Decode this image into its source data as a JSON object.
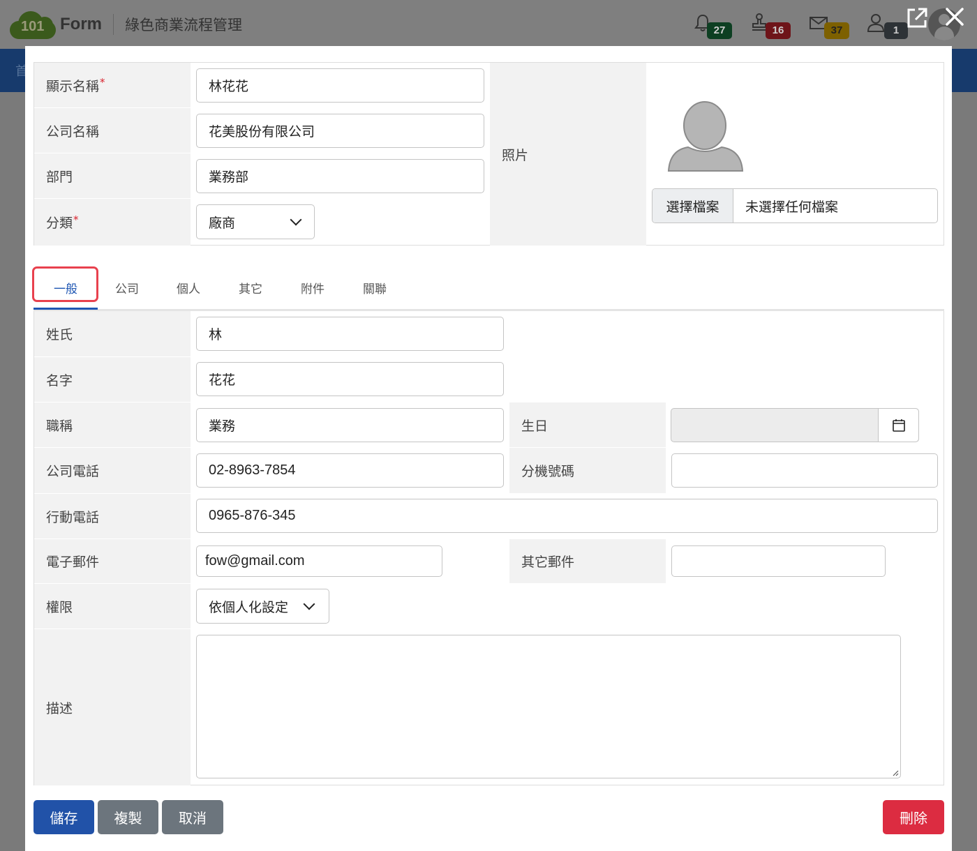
{
  "app": {
    "logo_number": "101",
    "logo_text": "Form",
    "title": "綠色商業流程管理",
    "nav_first_char": "首"
  },
  "header": {
    "notifications": [
      {
        "icon": "bell-icon",
        "count": "27",
        "color": "#0d3f22"
      },
      {
        "icon": "stamp-icon",
        "count": "16",
        "color": "#6e1419"
      },
      {
        "icon": "mail-icon",
        "count": "37",
        "color": "#7d6000"
      },
      {
        "icon": "user-icon",
        "count": "1",
        "color": "#2d3236"
      }
    ]
  },
  "form": {
    "display_name": {
      "label": "顯示名稱",
      "value": "林花花",
      "required": "*"
    },
    "company_name": {
      "label": "公司名稱",
      "value": "花美股份有限公司"
    },
    "department": {
      "label": "部門",
      "value": "業務部"
    },
    "category": {
      "label": "分類",
      "value": "廠商",
      "required": "*"
    },
    "photo": {
      "label": "照片",
      "choose_file": "選擇檔案",
      "file_status": "未選擇任何檔案"
    }
  },
  "tabs": [
    {
      "label": "一般",
      "active": true
    },
    {
      "label": "公司"
    },
    {
      "label": "個人"
    },
    {
      "label": "其它"
    },
    {
      "label": "附件"
    },
    {
      "label": "關聯"
    }
  ],
  "general": {
    "last_name": {
      "label": "姓氏",
      "value": "林"
    },
    "first_name": {
      "label": "名字",
      "value": "花花"
    },
    "job_title": {
      "label": "職稱",
      "value": "業務"
    },
    "birthday": {
      "label": "生日",
      "value": ""
    },
    "company_phone": {
      "label": "公司電話",
      "value": "02-8963-7854"
    },
    "extension": {
      "label": "分機號碼",
      "value": ""
    },
    "mobile": {
      "label": "行動電話",
      "value": "0965-876-345"
    },
    "email": {
      "label": "電子郵件",
      "value": "fow@gmail.com"
    },
    "other_email": {
      "label": "其它郵件",
      "value": ""
    },
    "permission": {
      "label": "權限",
      "value": "依個人化設定"
    },
    "description": {
      "label": "描述",
      "value": ""
    }
  },
  "buttons": {
    "save": "儲存",
    "copy": "複製",
    "cancel": "取消",
    "delete": "刪除"
  },
  "colors": {
    "primary": "#2152a8",
    "danger": "#dc2c41",
    "secondary": "#6c757d",
    "tab_active": "#1e56b3",
    "highlight": "#e8414e",
    "required": "#d9232e"
  }
}
